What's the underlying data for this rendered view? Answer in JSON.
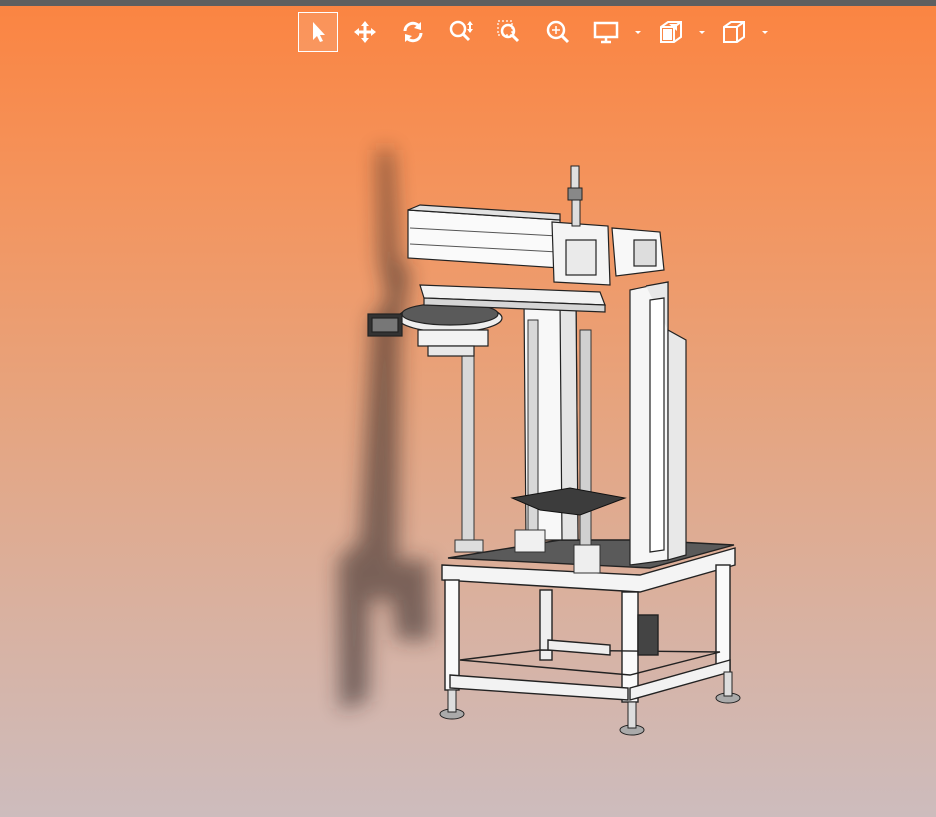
{
  "app": {
    "accent_color": "#fb8441",
    "background_top": "#fb8441",
    "background_bottom": "#cdbcbd",
    "icon_color": "#ffffff"
  },
  "toolbar": {
    "tools": [
      {
        "name": "select",
        "icon": "cursor-arrow-icon",
        "active": true
      },
      {
        "name": "pan",
        "icon": "move-arrows-icon",
        "active": false
      },
      {
        "name": "rotate",
        "icon": "rotate-icon",
        "active": false
      },
      {
        "name": "zoom",
        "icon": "zoom-updown-icon",
        "active": false
      },
      {
        "name": "zoom-window",
        "icon": "zoom-window-icon",
        "active": false
      },
      {
        "name": "zoom-fit",
        "icon": "zoom-fit-icon",
        "active": false
      },
      {
        "name": "display-mode",
        "icon": "monitor-icon",
        "active": false,
        "dropdown": true
      },
      {
        "name": "section-view",
        "icon": "section-box-icon",
        "active": false,
        "dropdown": true
      },
      {
        "name": "standard-views",
        "icon": "cube-icon",
        "active": false,
        "dropdown": true
      }
    ]
  },
  "viewport": {
    "content": "cad-machine-model"
  }
}
